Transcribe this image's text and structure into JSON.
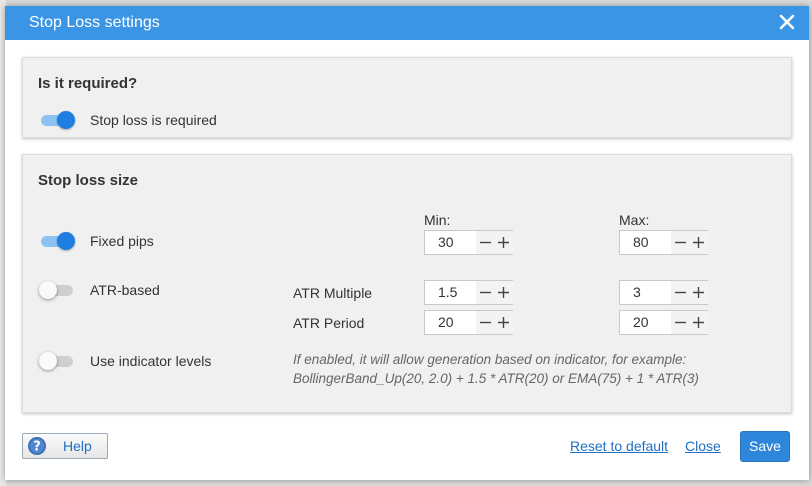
{
  "dialog": {
    "title": "Stop Loss settings"
  },
  "required_section": {
    "heading": "Is it required?",
    "toggle_label": "Stop loss is required",
    "toggle_on": true
  },
  "size_section": {
    "heading": "Stop loss size",
    "min_header": "Min:",
    "max_header": "Max:",
    "fixed_pips": {
      "label": "Fixed pips",
      "enabled": true,
      "min": "30",
      "max": "80"
    },
    "atr_based": {
      "label": "ATR-based",
      "enabled": false,
      "multiple_label": "ATR Multiple",
      "multiple_min": "1.5",
      "multiple_max": "3",
      "period_label": "ATR Period",
      "period_min": "20",
      "period_max": "20"
    },
    "indicator_levels": {
      "label": "Use indicator levels",
      "enabled": false,
      "hint_line1": "If enabled, it will allow generation based on indicator, for example:",
      "hint_line2": "BollingerBand_Up(20, 2.0) + 1.5 * ATR(20) or EMA(75) + 1 * ATR(3)"
    }
  },
  "footer": {
    "help_label": "Help",
    "reset_label": "Reset to default",
    "close_label": "Close",
    "save_label": "Save"
  },
  "colors": {
    "accent": "#3a95e4",
    "toggle_on": "#1f7fe0",
    "link": "#1f6fc4",
    "save_button": "#2d86d9"
  },
  "icons": {
    "close": "close-icon",
    "help": "question-circle-icon",
    "minus": "minus-icon",
    "plus": "plus-icon"
  }
}
